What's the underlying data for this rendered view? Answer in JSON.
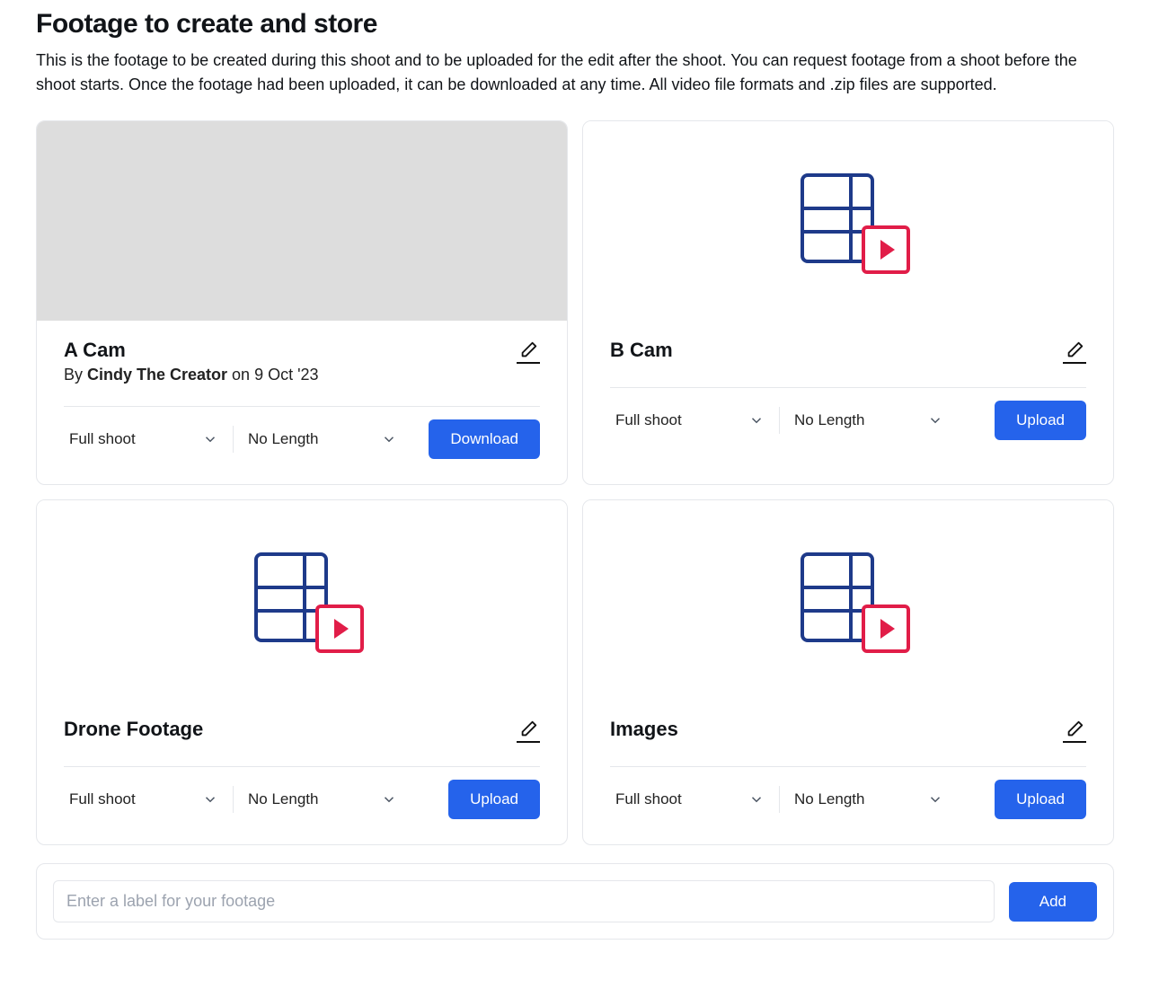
{
  "header": {
    "title": "Footage to create and store",
    "description": "This is the footage to be created during this shoot and to be uploaded for the edit after the shoot. You can request footage from a shoot before the shoot starts. Once the footage had been uploaded, it can be downloaded at any time. All video file formats and .zip files are supported."
  },
  "selects": {
    "type_default": "Full shoot",
    "length_default": "No Length"
  },
  "buttons": {
    "download": "Download",
    "upload": "Upload",
    "add": "Add"
  },
  "add_form": {
    "placeholder": "Enter a label for your footage"
  },
  "cards": [
    {
      "title": "A Cam",
      "has_thumb": true,
      "by_prefix": "By ",
      "author": "Cindy The Creator",
      "date_prefix": " on ",
      "date": "9 Oct '23",
      "action": "download"
    },
    {
      "title": "B Cam",
      "has_thumb": false,
      "action": "upload"
    },
    {
      "title": "Drone Footage",
      "has_thumb": false,
      "action": "upload"
    },
    {
      "title": "Images",
      "has_thumb": false,
      "action": "upload"
    }
  ]
}
